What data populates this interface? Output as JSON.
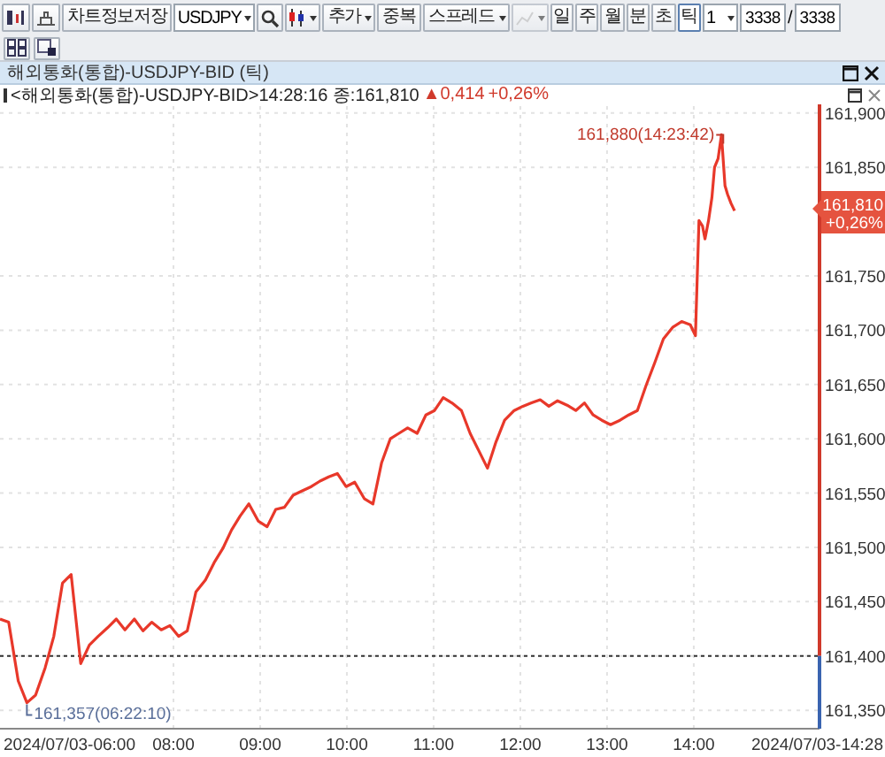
{
  "toolbar": {
    "save_button": "차트정보저장",
    "symbol": "USDJPY",
    "add_menu": "추가",
    "overlap_button": "중복",
    "spread_menu": "스프레드",
    "periods": [
      {
        "label": "일",
        "selected": false
      },
      {
        "label": "주",
        "selected": false
      },
      {
        "label": "월",
        "selected": false
      },
      {
        "label": "분",
        "selected": false
      },
      {
        "label": "초",
        "selected": false
      },
      {
        "label": "틱",
        "selected": true
      }
    ],
    "interval": "1",
    "count": "3338",
    "separator": "/",
    "total": "3338"
  },
  "window": {
    "title": "해외통화(통합)-USDJPY-BID (틱)"
  },
  "info": {
    "text": "<해외통화(통합)-USDJPY-BID>14:28:16 종:161,810",
    "change": "▲0,414",
    "change_pct": "+0,26%"
  },
  "chart": {
    "last_price": "161,810",
    "last_change": "+0,26%",
    "start_label": "2024/07/03-06:00",
    "end_label": "2024/07/03-14:28",
    "chart_data": {
      "type": "line",
      "x": [
        6.0,
        6.1,
        6.21,
        6.31,
        6.41,
        6.52,
        6.62,
        6.72,
        6.82,
        6.93,
        7.03,
        7.13,
        7.24,
        7.34,
        7.44,
        7.55,
        7.65,
        7.75,
        7.86,
        7.96,
        8.06,
        8.16,
        8.26,
        8.37,
        8.47,
        8.57,
        8.67,
        8.77,
        8.87,
        8.98,
        9.08,
        9.18,
        9.28,
        9.38,
        9.48,
        9.59,
        9.69,
        9.79,
        9.89,
        9.99,
        10.09,
        10.2,
        10.3,
        10.4,
        10.5,
        10.6,
        10.7,
        10.81,
        10.91,
        11.01,
        11.11,
        11.21,
        11.32,
        11.42,
        11.52,
        11.62,
        11.72,
        11.82,
        11.93,
        12.03,
        12.13,
        12.23,
        12.33,
        12.43,
        12.54,
        12.64,
        12.74,
        12.84,
        12.94,
        13.04,
        13.15,
        13.25,
        13.35,
        13.45,
        13.55,
        13.65,
        13.76,
        13.86,
        13.96,
        14.02,
        14.06,
        14.1,
        14.13,
        14.17,
        14.21,
        14.24,
        14.28,
        14.32,
        14.36,
        14.39,
        14.43,
        14.47
      ],
      "series": [
        {
          "values": [
            161.434,
            161.431,
            161.377,
            161.357,
            161.364,
            161.389,
            161.418,
            161.467,
            161.475,
            161.393,
            161.41,
            161.418,
            161.426,
            161.434,
            161.424,
            161.434,
            161.423,
            161.431,
            161.424,
            161.428,
            161.418,
            161.423,
            161.459,
            161.47,
            161.486,
            161.499,
            161.516,
            161.529,
            161.54,
            161.524,
            161.519,
            161.535,
            161.537,
            161.548,
            161.552,
            161.556,
            161.561,
            161.565,
            161.568,
            161.556,
            161.56,
            161.545,
            161.54,
            161.578,
            161.6,
            161.605,
            161.61,
            161.605,
            161.622,
            161.626,
            161.638,
            161.633,
            161.626,
            161.605,
            161.589,
            161.573,
            161.597,
            161.617,
            161.626,
            161.63,
            161.633,
            161.636,
            161.63,
            161.635,
            161.631,
            161.626,
            161.633,
            161.622,
            161.617,
            161.613,
            161.617,
            161.622,
            161.626,
            161.649,
            161.67,
            161.692,
            161.703,
            161.708,
            161.705,
            161.695,
            161.801,
            161.796,
            161.784,
            161.801,
            161.822,
            161.85,
            161.858,
            161.88,
            161.833,
            161.825,
            161.817,
            161.81
          ]
        }
      ],
      "xlim": [
        6,
        15.45
      ],
      "ylim": [
        161.333,
        161.908
      ],
      "xticks": [
        {
          "value": 8,
          "label": "08:00"
        },
        {
          "value": 9,
          "label": "09:00"
        },
        {
          "value": 10,
          "label": "10:00"
        },
        {
          "value": 11,
          "label": "11:00"
        },
        {
          "value": 12,
          "label": "12:00"
        },
        {
          "value": 13,
          "label": "13:00"
        },
        {
          "value": 14,
          "label": "14:00"
        }
      ],
      "yticks": [
        {
          "value": 161.9,
          "label": "161,900"
        },
        {
          "value": 161.85,
          "label": "161,850"
        },
        {
          "value": 161.75,
          "label": "161,750"
        },
        {
          "value": 161.7,
          "label": "161,700"
        },
        {
          "value": 161.65,
          "label": "161,650"
        },
        {
          "value": 161.6,
          "label": "161,600"
        },
        {
          "value": 161.55,
          "label": "161,550"
        },
        {
          "value": 161.5,
          "label": "161,500"
        },
        {
          "value": 161.45,
          "label": "161,450"
        },
        {
          "value": 161.4,
          "label": "161,400"
        },
        {
          "value": 161.35,
          "label": "161,350"
        }
      ],
      "grid": true,
      "ref_lines": [
        {
          "axis": "y",
          "value": 161.4
        }
      ],
      "annotations": [
        {
          "x": 14.32,
          "y": 161.88,
          "text": "161,880(14:23:42)"
        },
        {
          "x": 6.31,
          "y": 161.357,
          "text": "161,357(06:22:10)"
        }
      ]
    }
  }
}
